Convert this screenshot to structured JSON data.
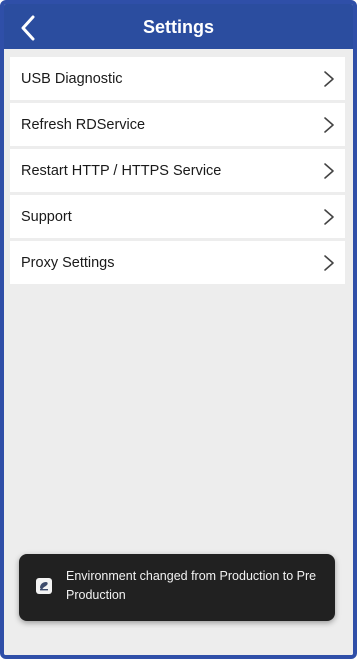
{
  "header": {
    "title": "Settings",
    "back_icon": "chevron-left-icon"
  },
  "settings": {
    "items": [
      {
        "label": "USB Diagnostic"
      },
      {
        "label": "Refresh RDService"
      },
      {
        "label": "Restart HTTP / HTTPS Service"
      },
      {
        "label": "Support"
      },
      {
        "label": "Proxy Settings"
      }
    ],
    "item_icon": "chevron-right-icon"
  },
  "toast": {
    "icon": "app-icon",
    "message": "Environment changed from Production to Pre Production"
  },
  "colors": {
    "app_bar": "#2b4d9f",
    "background": "#ededed",
    "toast": "#212121"
  }
}
